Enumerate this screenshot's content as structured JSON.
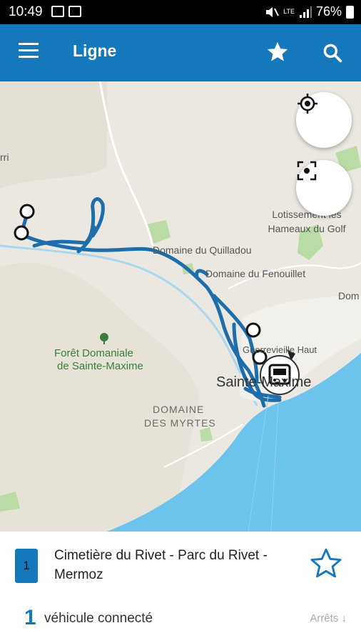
{
  "status_bar": {
    "time": "10:49",
    "battery": "76%",
    "network": "LTE"
  },
  "app_bar": {
    "title": "Ligne",
    "icons": [
      "menu-icon",
      "star-icon",
      "search-icon"
    ]
  },
  "map": {
    "labels": {
      "lotissement": "Lotissement les Hameaux du Golf",
      "quilladou": "Domaine du Quilladou",
      "fenouillet": "Domaine du Fenouillet",
      "dom": "Dom",
      "foret_1": "Forêt Domaniale",
      "foret_2": "de Sainte-Maxime",
      "guerrevieille": "Guerrevieille Haut",
      "city": "Sainte-Maxime",
      "myrtes_1": "DOMAINE",
      "myrtes_2": "DES MYRTES",
      "edge": "rri"
    },
    "buttons": [
      "locate-icon",
      "focus-icon"
    ]
  },
  "line": {
    "number": "1",
    "name": "Cimetière du Rivet - Parc du Rivet - Mermoz",
    "favorite_icon": "star-outline-icon"
  },
  "vehicles": {
    "count": "1",
    "label": "véhicule connecté",
    "stops_link": "Arrêts ↓"
  },
  "colors": {
    "primary": "#1478bb",
    "sea": "#6cc3ec",
    "route": "#1d6eaa"
  }
}
